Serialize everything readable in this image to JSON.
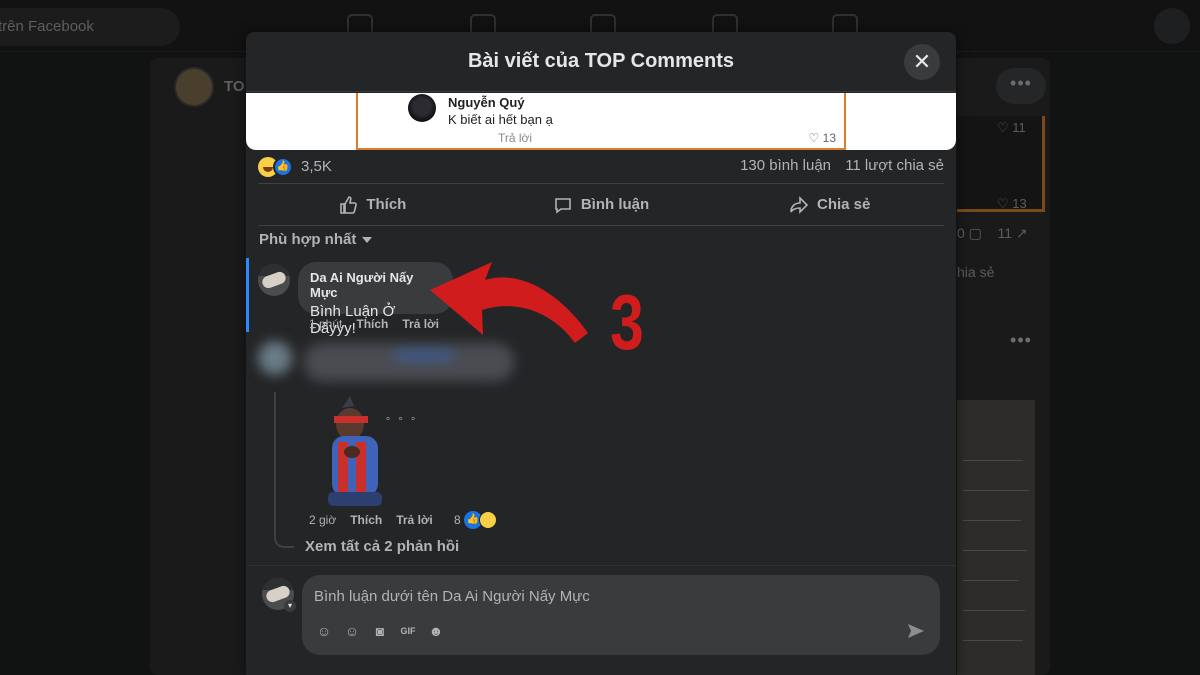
{
  "background": {
    "search_text": "trên Facebook",
    "page_name_fragment": "TO",
    "dots_label": "•••",
    "right_like_count_1": "11",
    "right_like_count_2": "13",
    "right_stats": "0",
    "right_share_count": "11",
    "right_share_label": "hia sẻ"
  },
  "modal": {
    "title": "Bài viết của TOP Comments",
    "close_icon": "close-icon"
  },
  "post_image": {
    "commenter_name": "Nguyễn Quý",
    "comment_text": "K biết ai hết bạn ạ",
    "reply_label": "Trả lời",
    "like_count": "13"
  },
  "stats": {
    "reaction_count": "3,5K",
    "comments": "130 bình luận",
    "shares": "11 lượt chia sẻ"
  },
  "actions": {
    "like": "Thích",
    "comment": "Bình luận",
    "share": "Chia sẻ"
  },
  "sort": {
    "label": "Phù hợp nhất"
  },
  "comment_1": {
    "author": "Da Ai Người Nấy Mực",
    "text": "Bình Luận Ở Đâyyy!",
    "time": "1 phút",
    "like": "Thích",
    "reply": "Trả lời"
  },
  "reply_1": {
    "typing": "˚ ˚ ˚",
    "time": "2 giờ",
    "like": "Thích",
    "reply": "Trả lời",
    "reaction_count": "8",
    "see_all": "Xem tất cả 2 phản hồi"
  },
  "composer": {
    "placeholder": "Bình luận dưới tên Da Ai Người Nấy Mực"
  },
  "annotation": {
    "number": "3",
    "color": "#d01c1c"
  },
  "colors": {
    "modal_bg": "#242526",
    "bubble_bg": "#3a3b3c",
    "text_primary": "#e4e6eb",
    "text_secondary": "#b0b3b8",
    "accent_blue": "#2d88ff",
    "frame_orange": "#e07a2c"
  }
}
